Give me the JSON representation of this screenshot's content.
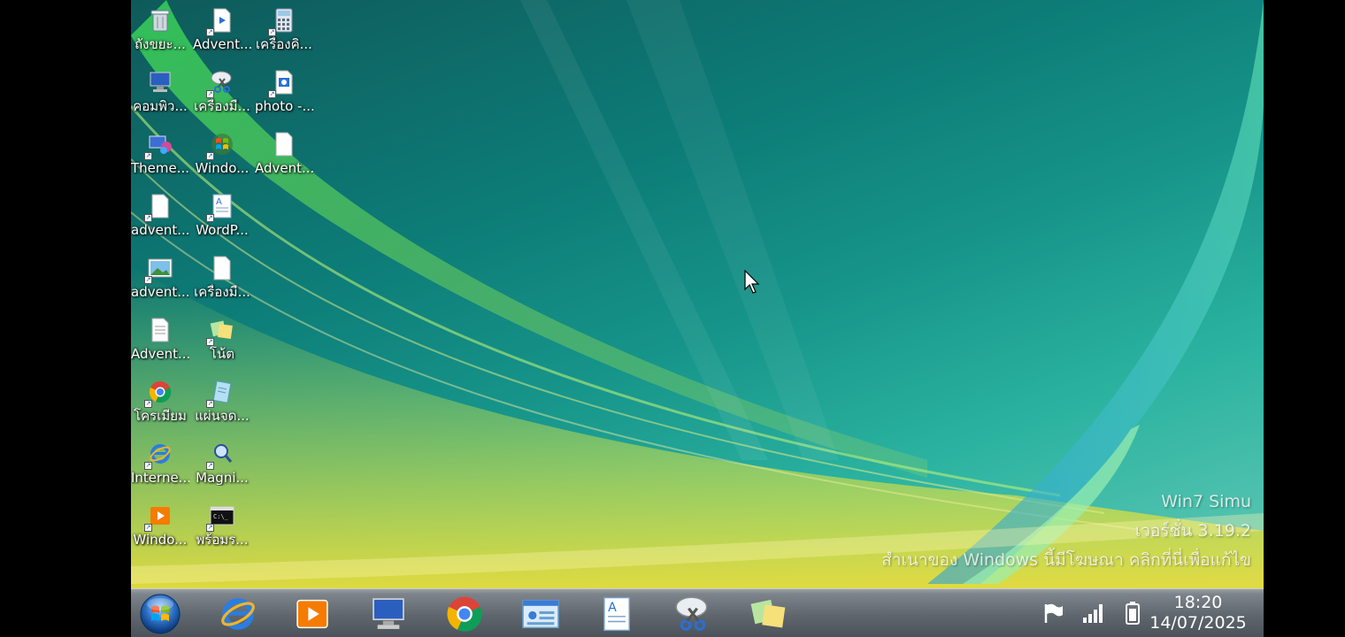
{
  "desktop": {
    "icons": [
      {
        "label": "ถังขยะ...",
        "icon": "recycle-bin-icon",
        "shortcut": false
      },
      {
        "label": "Advent...",
        "icon": "media-file-icon",
        "shortcut": true
      },
      {
        "label": "เครื่องคิ...",
        "icon": "calculator-icon",
        "shortcut": true
      },
      {
        "label": "คอมพิว...",
        "icon": "computer-icon",
        "shortcut": false
      },
      {
        "label": "เครื่องมื...",
        "icon": "snipping-tool-icon",
        "shortcut": true
      },
      {
        "label": "photo -...",
        "icon": "photo-viewer-icon",
        "shortcut": true
      },
      {
        "label": "Theme...",
        "icon": "themes-icon",
        "shortcut": true
      },
      {
        "label": "Windo...",
        "icon": "windows-logo-icon",
        "shortcut": true
      },
      {
        "label": "Advent...",
        "icon": "document-icon",
        "shortcut": false
      },
      {
        "label": "advent...",
        "icon": "document-icon",
        "shortcut": true
      },
      {
        "label": "WordP...",
        "icon": "wordpad-icon",
        "shortcut": true
      },
      {
        "label": "advent...",
        "icon": "image-file-icon",
        "shortcut": true
      },
      {
        "label": "เครื่องมื...",
        "icon": "document-icon",
        "shortcut": false
      },
      {
        "label": "Advent...",
        "icon": "text-file-icon",
        "shortcut": false
      },
      {
        "label": "โน้ต",
        "icon": "sticky-notes-icon",
        "shortcut": true
      },
      {
        "label": "โครเมียม",
        "icon": "chrome-icon",
        "shortcut": true
      },
      {
        "label": "แผ่นจด...",
        "icon": "notepad-icon",
        "shortcut": true
      },
      {
        "label": "Interne...",
        "icon": "internet-explorer-icon",
        "shortcut": true
      },
      {
        "label": "Magni...",
        "icon": "magnifier-icon",
        "shortcut": true
      },
      {
        "label": "Windo...",
        "icon": "media-player-icon",
        "shortcut": true
      },
      {
        "label": "พร้อมร...",
        "icon": "command-prompt-icon",
        "shortcut": true
      }
    ]
  },
  "watermark": {
    "line1": "Win7 Simu",
    "line2": "เวอร์ชั่น 3.19.2",
    "line3": "สำเนาของ Windows นี้มีโฆษณา คลิกที่นี่เพื่อแก้ไข"
  },
  "taskbar": {
    "pinned": [
      {
        "icon": "internet-explorer-icon"
      },
      {
        "icon": "media-player-icon"
      },
      {
        "icon": "computer-icon"
      },
      {
        "icon": "chrome-icon"
      },
      {
        "icon": "control-panel-icon"
      },
      {
        "icon": "wordpad-icon"
      },
      {
        "icon": "snipping-tool-icon"
      },
      {
        "icon": "sticky-notes-icon"
      }
    ],
    "tray": {
      "icons": [
        "action-center-flag-icon",
        "signal-strength-icon",
        "battery-icon"
      ],
      "time": "18:20",
      "date": "14/07/2025"
    }
  }
}
